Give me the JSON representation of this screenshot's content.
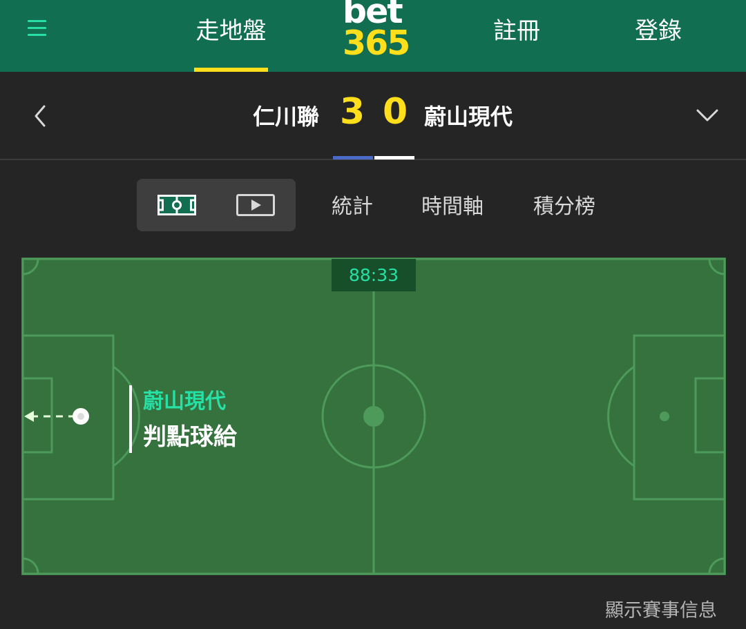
{
  "header": {
    "nav": {
      "live": "走地盤",
      "register": "註冊",
      "login": "登錄"
    },
    "logo": {
      "top": "bet",
      "bottom": "365"
    },
    "icons": {
      "menu": "hamburger-menu-icon"
    }
  },
  "match": {
    "home_team": "仁川聯",
    "away_team": "蔚山現代",
    "home_score": "3",
    "away_score": "0",
    "home_kit_color": "#4a6ac8",
    "away_kit_color": "#ffffff",
    "icons": {
      "back": "chevron-left-icon",
      "collapse": "chevron-down-icon"
    }
  },
  "tabs": {
    "view_icons": [
      "pitch-view-icon",
      "video-play-icon"
    ],
    "stats": "統計",
    "timeline": "時間軸",
    "standings": "積分榜"
  },
  "pitch": {
    "clock": "88:33",
    "event_team": "蔚山現代",
    "event_type": "判點球給"
  },
  "footer": {
    "show_info": "顯示賽事信息"
  },
  "colors": {
    "brand_green": "#126e51",
    "accent_yellow": "#ffdf1b",
    "accent_teal": "#27e0a5",
    "pitch_green": "#35723e"
  }
}
